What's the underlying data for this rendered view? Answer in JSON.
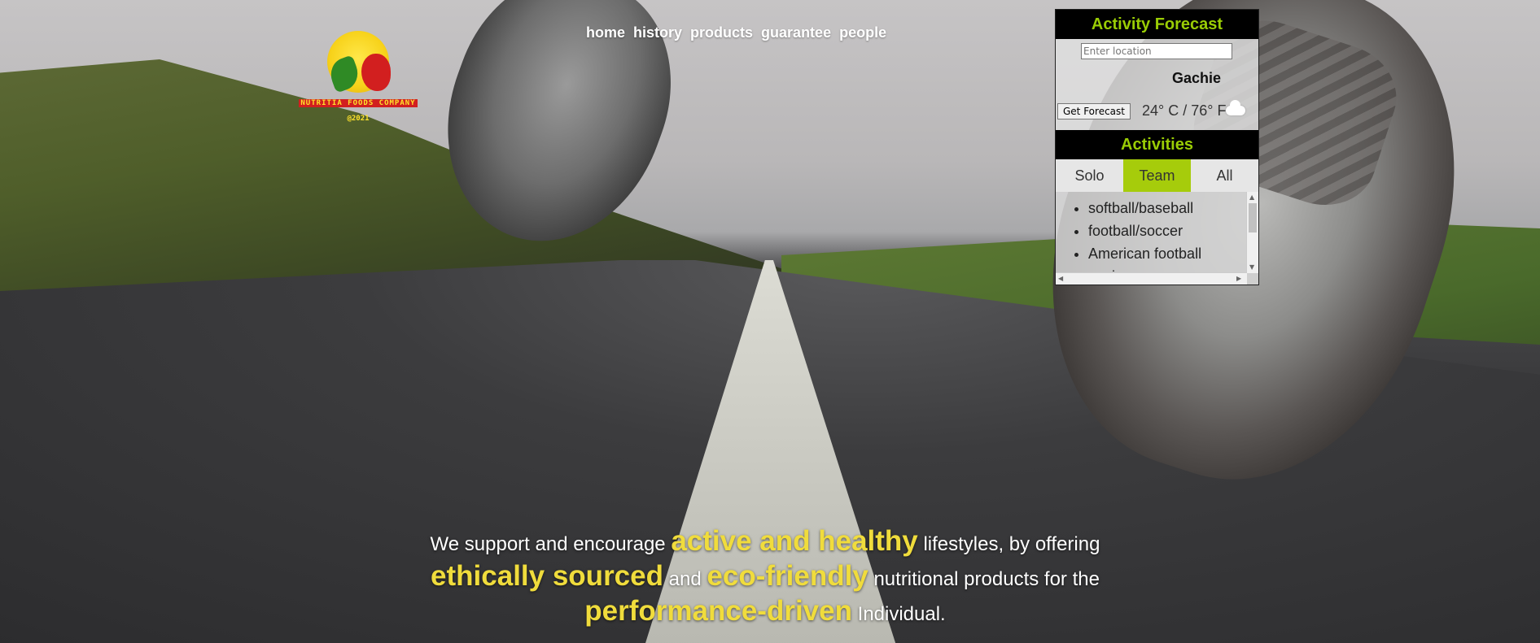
{
  "logo": {
    "company": "NUTRITIA FOODS COMPANY",
    "year": "@2021"
  },
  "nav": [
    "home",
    "history",
    "products",
    "guarantee",
    "people"
  ],
  "weather": {
    "title": "Activity Forecast",
    "location_placeholder": "Enter location",
    "city": "Gachie",
    "button_label": "Get Forecast",
    "temperature": "24° C / 76° F",
    "condition_icon": "cloud-icon"
  },
  "activities": {
    "title": "Activities",
    "tabs": [
      "Solo",
      "Team",
      "All"
    ],
    "active_tab": "Team",
    "items": [
      "softball/baseball",
      "football/soccer",
      "American football",
      "rowing"
    ],
    "accent_color": "#a6cc0b"
  },
  "tagline": {
    "p1": "We support and encourage",
    "h1": "active and healthy",
    "p2": "lifestyles, by offering",
    "h2": "ethically sourced",
    "p3": "and",
    "h3": "eco-friendly",
    "p4": "nutritional products for the",
    "h4": "performance-driven",
    "p5": "Individual.",
    "highlight_color": "#f0dc3c"
  }
}
